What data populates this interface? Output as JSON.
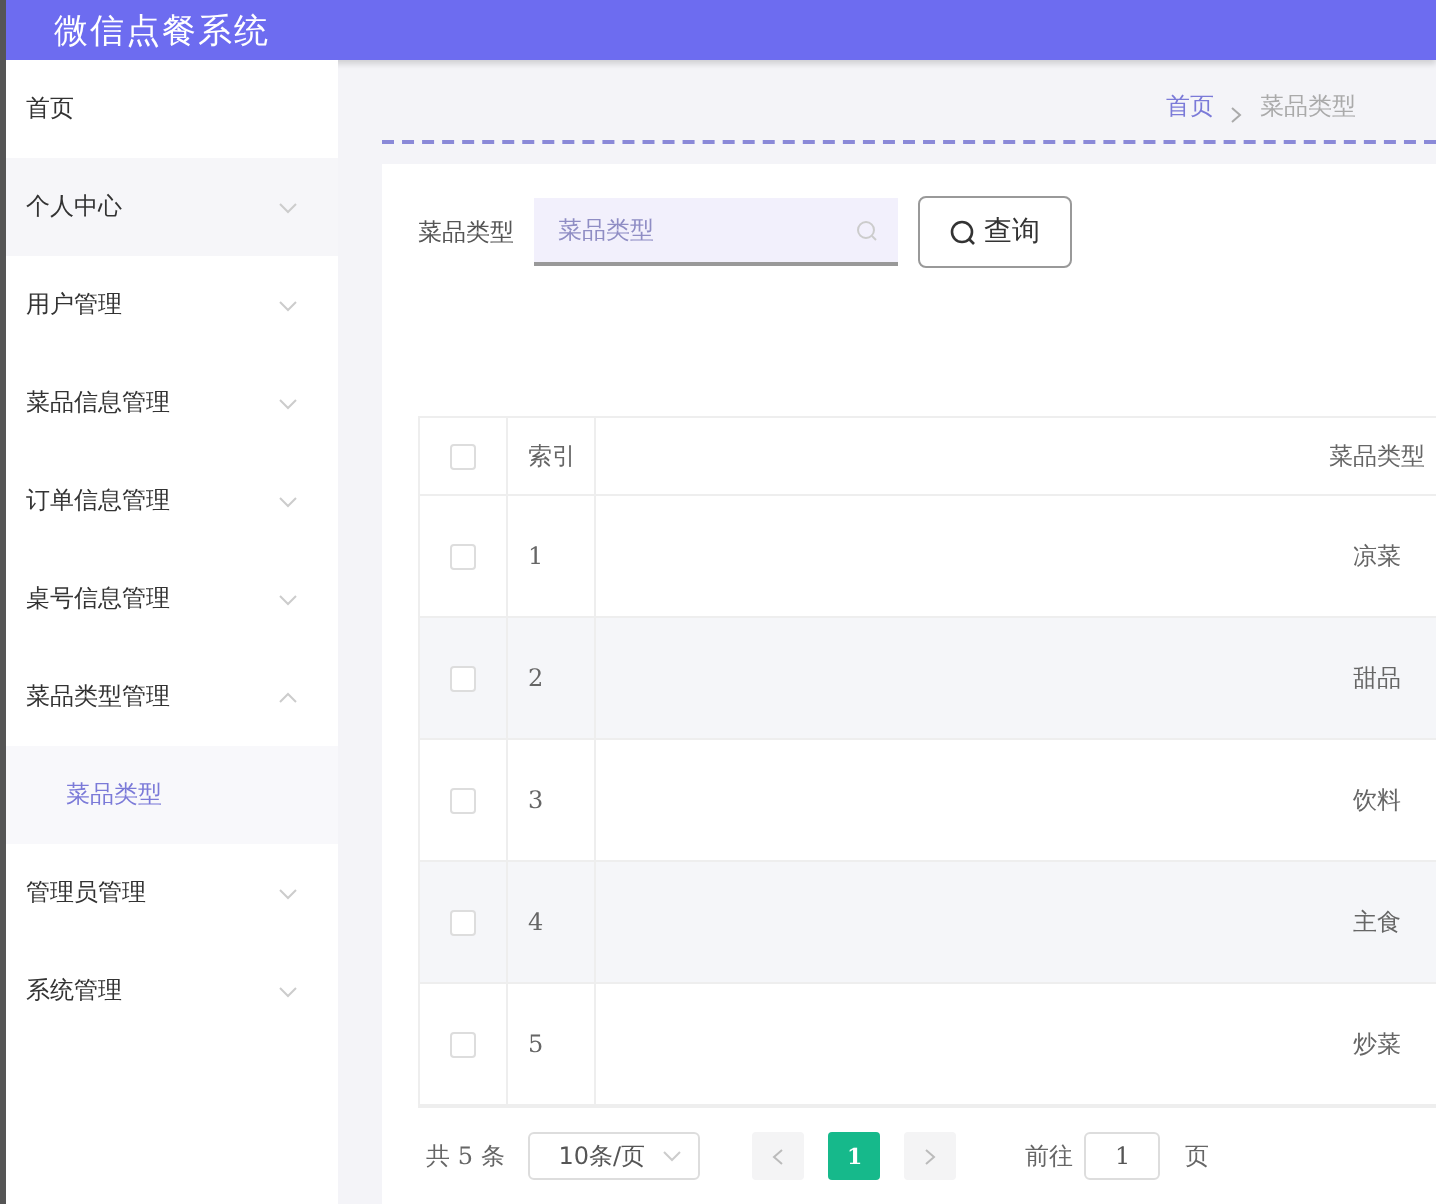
{
  "header": {
    "title": "微信点餐系统"
  },
  "sidebar": {
    "items": [
      {
        "label": "首页",
        "kind": "link"
      },
      {
        "label": "个人中心",
        "kind": "menu",
        "expanded": false,
        "hovered": true
      },
      {
        "label": "用户管理",
        "kind": "menu",
        "expanded": false
      },
      {
        "label": "菜品信息管理",
        "kind": "menu",
        "expanded": false
      },
      {
        "label": "订单信息管理",
        "kind": "menu",
        "expanded": false
      },
      {
        "label": "桌号信息管理",
        "kind": "menu",
        "expanded": false
      },
      {
        "label": "菜品类型管理",
        "kind": "menu",
        "expanded": true,
        "children": [
          {
            "label": "菜品类型",
            "selected": true
          }
        ]
      },
      {
        "label": "管理员管理",
        "kind": "menu",
        "expanded": false
      },
      {
        "label": "系统管理",
        "kind": "menu",
        "expanded": false
      }
    ]
  },
  "breadcrumb": [
    "首页",
    "菜品类型"
  ],
  "search": {
    "label": "菜品类型",
    "placeholder": "菜品类型",
    "button": "查询"
  },
  "table": {
    "columns": [
      "索引",
      "菜品类型"
    ],
    "all_checked": false,
    "rows": [
      {
        "index": "1",
        "type": "凉菜",
        "checked": false
      },
      {
        "index": "2",
        "type": "甜品",
        "checked": false
      },
      {
        "index": "3",
        "type": "饮料",
        "checked": false
      },
      {
        "index": "4",
        "type": "主食",
        "checked": false
      },
      {
        "index": "5",
        "type": "炒菜",
        "checked": false
      }
    ]
  },
  "pagination": {
    "total": "共 5 条",
    "page_size": "10条/页",
    "pages": [
      {
        "label": "1",
        "selected": true
      }
    ],
    "goto_label": "前往",
    "goto_value": "1",
    "goto_suffix": "页"
  }
}
